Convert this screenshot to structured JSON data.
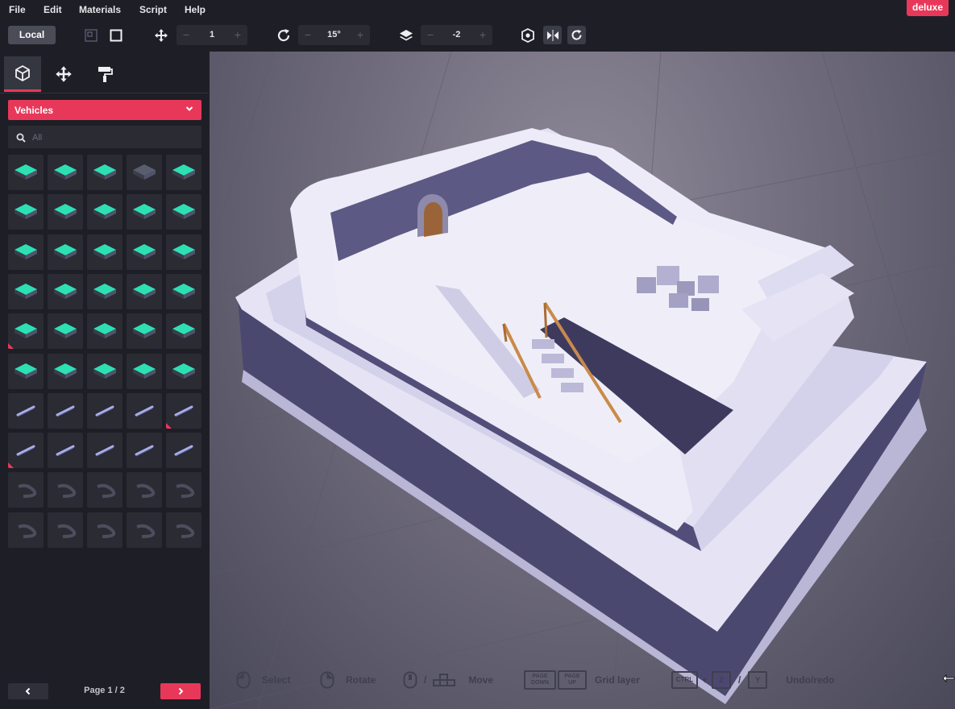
{
  "menu": {
    "items": [
      "File",
      "Edit",
      "Materials",
      "Script",
      "Help"
    ],
    "badge": "deluxe"
  },
  "toolbar": {
    "space_label": "Local",
    "move_step": "1",
    "rotate_step": "15°",
    "grid_layer": "-2",
    "minus": "−",
    "plus": "+"
  },
  "sidebar": {
    "tabs": [
      "build-tab",
      "move-tab",
      "paint-tab"
    ],
    "category": "Vehicles",
    "search_placeholder": "All",
    "page_label": "Page 1 / 2"
  },
  "hints": {
    "select": "Select",
    "rotate": "Rotate",
    "move": "Move",
    "grid_layer": "Grid layer",
    "undo_redo": "Undo/redo",
    "key_page_down": "PAGE DOWN",
    "key_page_up": "PAGE UP",
    "key_ctrl": "CTRL",
    "key_z": "Z",
    "key_y": "Y",
    "plus": "+",
    "slash": "/"
  },
  "colors": {
    "accent": "#e8385a",
    "panel": "#1e1f26",
    "tile": "#2a2b33",
    "teal": "#2de0b4",
    "model_top": "#eceaf7",
    "model_side": "#56527a"
  }
}
